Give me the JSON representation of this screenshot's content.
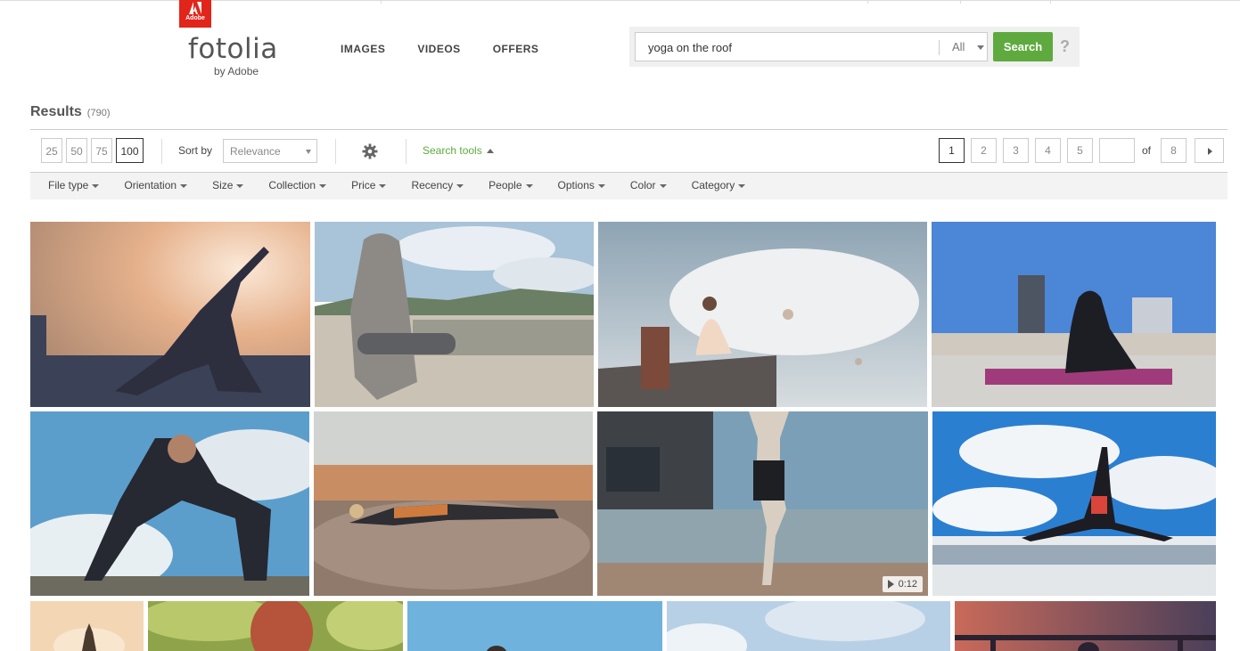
{
  "brand": {
    "badge": "Adobe",
    "name": "fotolia",
    "tagline": "by Adobe"
  },
  "nav": [
    "IMAGES",
    "VIDEOS",
    "OFFERS"
  ],
  "search": {
    "query": "yoga on the roof",
    "scope": "All",
    "button": "Search",
    "help": "?"
  },
  "results": {
    "label": "Results",
    "count": "(790)"
  },
  "toolbar": {
    "per_page": [
      "25",
      "50",
      "75",
      "100"
    ],
    "per_page_selected": "100",
    "sort_label": "Sort by",
    "sort_value": "Relevance",
    "search_tools": "Search tools"
  },
  "pagination": {
    "pages": [
      "1",
      "2",
      "3",
      "4",
      "5"
    ],
    "current": "1",
    "of_label": "of",
    "total": "8"
  },
  "filters": [
    "File type",
    "Orientation",
    "Size",
    "Collection",
    "Price",
    "Recency",
    "People",
    "Options",
    "Color",
    "Category"
  ],
  "video_duration": "0:12",
  "icons": [
    "adobe-logo-icon",
    "dropdown-caret-icon",
    "gear-icon",
    "caret-up-icon",
    "next-page-icon",
    "play-icon"
  ]
}
